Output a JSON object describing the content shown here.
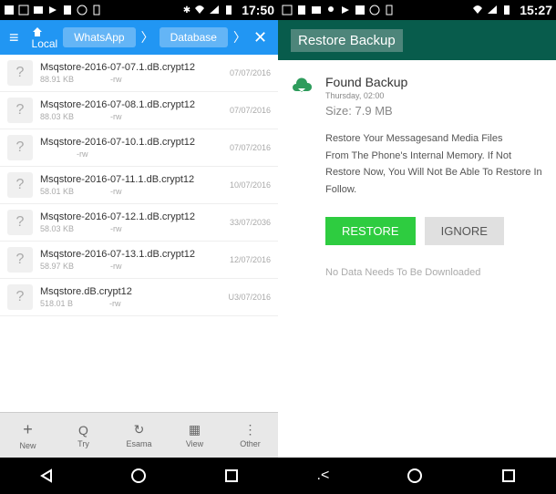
{
  "left": {
    "statusbar_time": "17:50",
    "breadcrumb": {
      "local": "Local",
      "whatsapp": "WhatsApp",
      "database": "Database"
    },
    "files": [
      {
        "name": "Msqstore-2016-07-07.1.dB.crypt12",
        "size": "88.91 KB",
        "perm": "-rw",
        "date": "07/07/2016"
      },
      {
        "name": "Msqstore-2016-07-08.1.dB.crypt12",
        "size": "88.03 KB",
        "perm": "-rw",
        "date": "07/07/2016"
      },
      {
        "name": "Msqstore-2016-07-10.1.dB.crypt12",
        "size": "",
        "perm": "-rw",
        "date": "07/07/2016"
      },
      {
        "name": "Msqstore-2016-07-11.1.dB.crypt12",
        "size": "58.01 KB",
        "perm": "-rw",
        "date": "10/07/2016"
      },
      {
        "name": "Msqstore-2016-07-12.1.dB.crypt12",
        "size": "58.03 KB",
        "perm": "-rw",
        "date": "33/07/2036"
      },
      {
        "name": "Msqstore-2016-07-13.1.dB.crypt12",
        "size": "58.97 KB",
        "perm": "-rw",
        "date": "12/07/2016"
      },
      {
        "name": "Msqstore.dB.crypt12",
        "size": "518.01 B",
        "perm": "-rw",
        "date": "U3/07/2016"
      }
    ],
    "toolbar": {
      "new": "New",
      "try": "Try",
      "esama": "Esama",
      "view": "View",
      "other": "Other"
    }
  },
  "right": {
    "statusbar_time": "15:27",
    "header_title": "Restore Backup",
    "found_backup": "Found Backup",
    "backup_date": "Thursday, 02:00",
    "backup_size": "Size: 7.9 MB",
    "restore_text_1": "Restore Your Messagesand Media Files",
    "restore_text_2": "From The Phone's Internal Memory. If Not",
    "restore_text_3": "Restore Now, You Will Not Be Able To Restore In",
    "restore_text_4": "Follow.",
    "restore_btn": "RESTORE",
    "ignore_btn": "IGNORE",
    "no_data": "No Data Needs To Be Downloaded"
  }
}
